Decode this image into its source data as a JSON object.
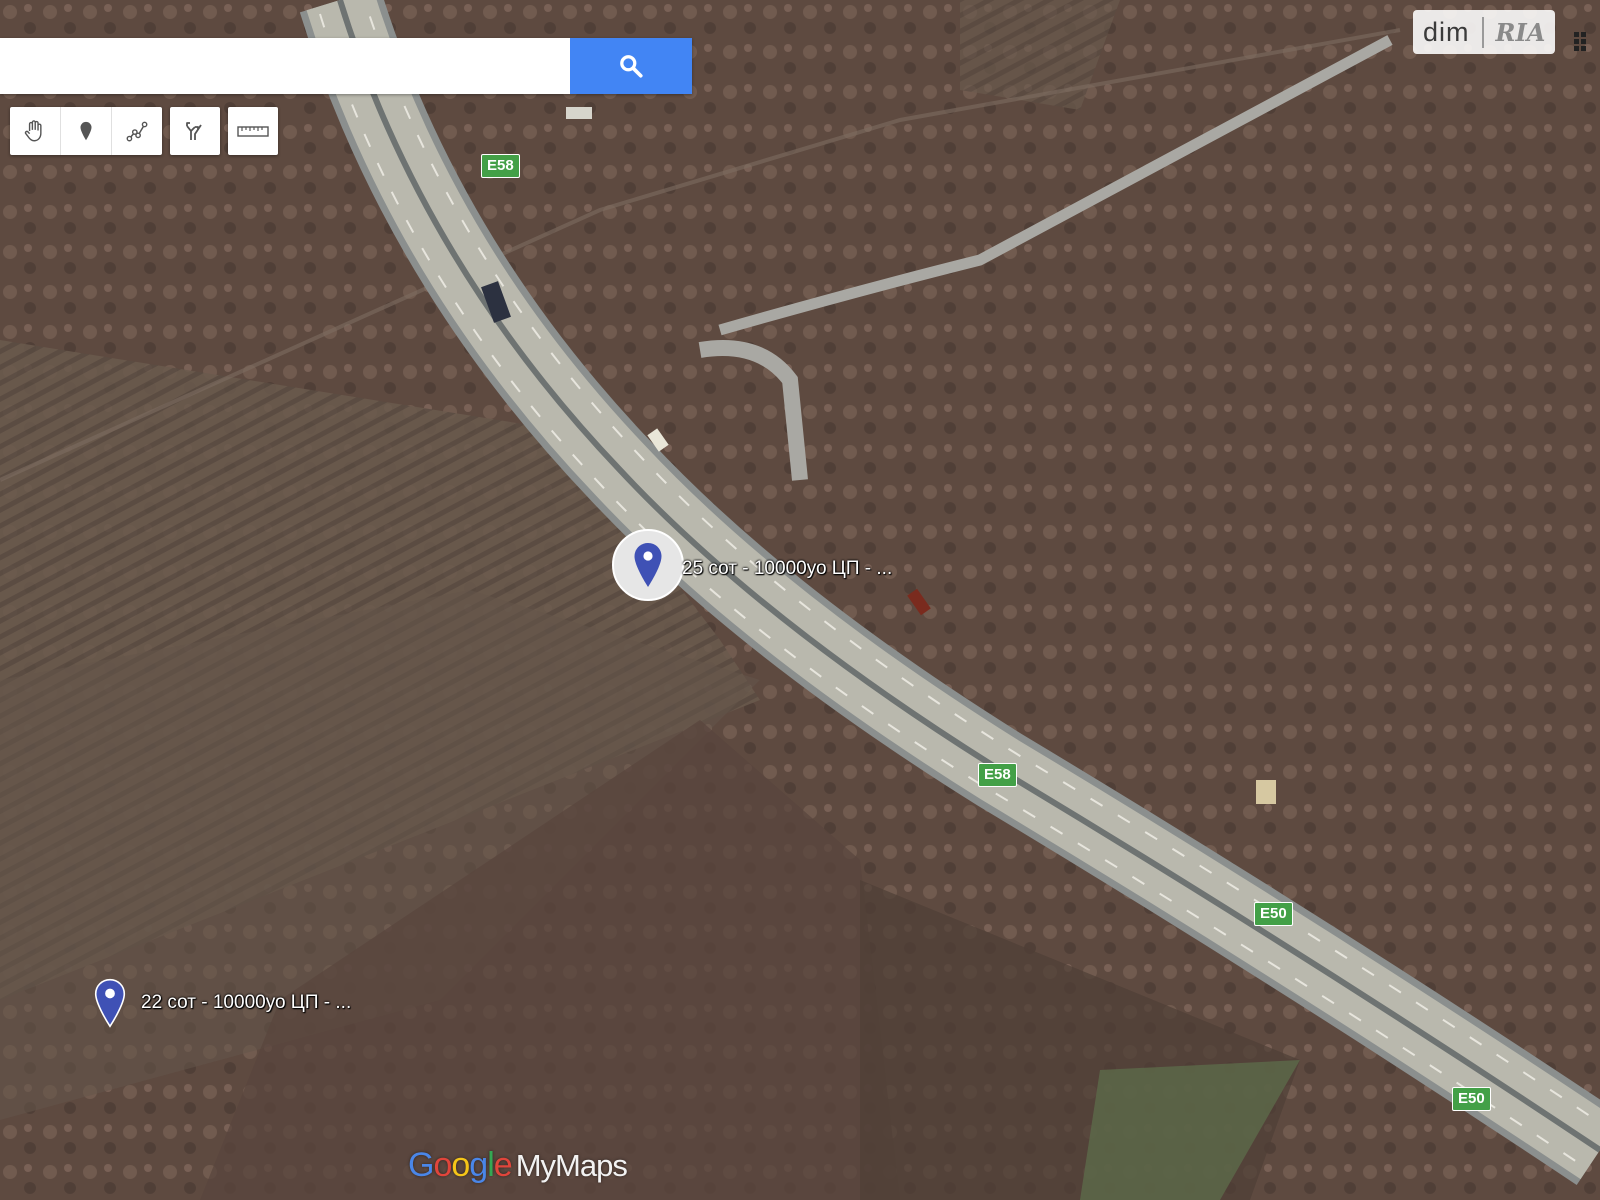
{
  "search": {
    "placeholder": "",
    "value": ""
  },
  "toolbar": {
    "tools": [
      {
        "icon": "hand-icon"
      },
      {
        "icon": "pin-icon"
      },
      {
        "icon": "line-icon"
      }
    ],
    "route_icon": "directions-icon",
    "measure_icon": "ruler-icon"
  },
  "brand": {
    "dim": "dim",
    "ria": "RIA"
  },
  "highways": [
    "E58",
    "E58",
    "E50",
    "E50"
  ],
  "markers": [
    {
      "label": "25 сот - 10000уо ЦП - ...",
      "selected": true,
      "color": "#3f51b5"
    },
    {
      "label": "22 сот - 10000уо ЦП - ...",
      "selected": false,
      "color": "#3f51b5"
    }
  ],
  "footer": {
    "google": [
      "G",
      "o",
      "o",
      "g",
      "l",
      "e"
    ],
    "mymaps": "MyMaps"
  },
  "colors": {
    "search_button": "#4285f4",
    "highway_shield": "#43a047",
    "marker": "#3f51b5"
  }
}
